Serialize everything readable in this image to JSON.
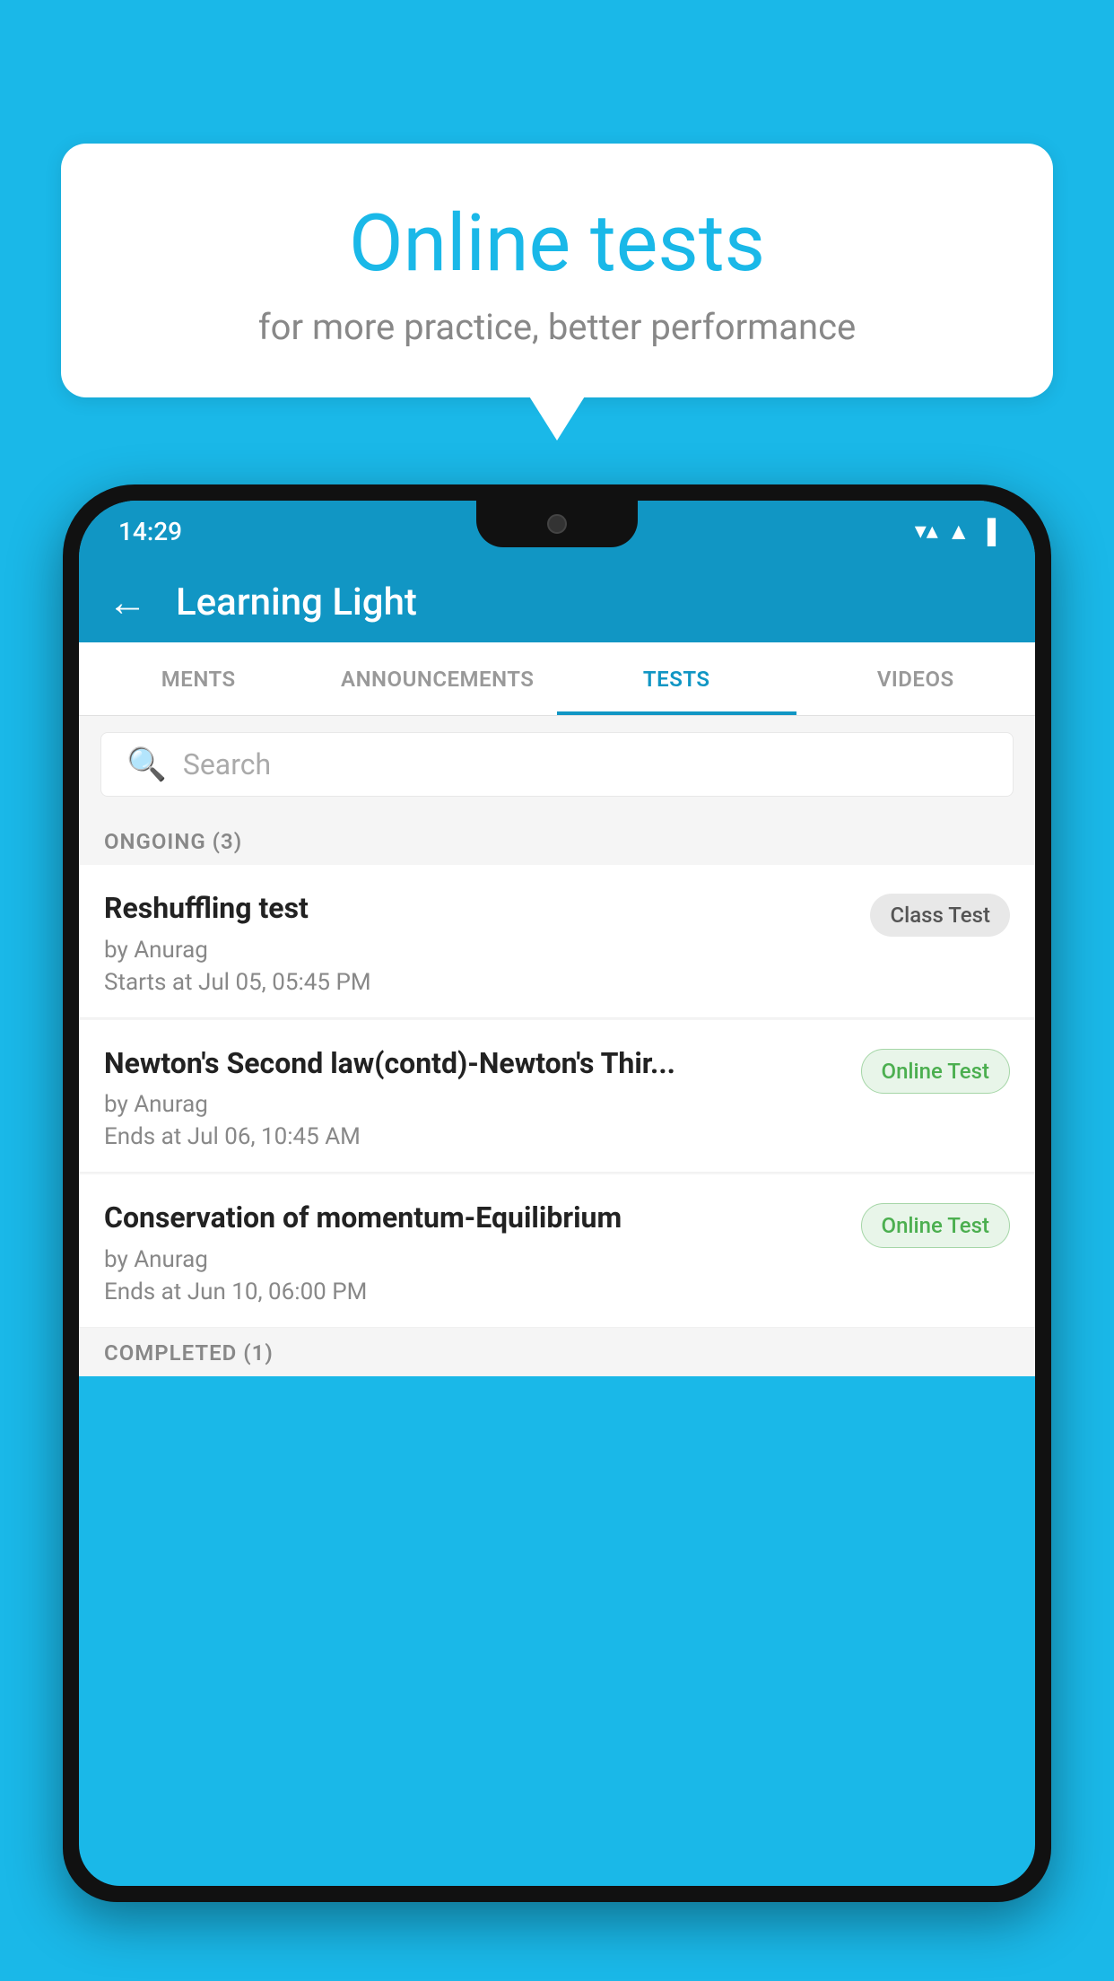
{
  "background": {
    "color": "#1ab8e8"
  },
  "speech_bubble": {
    "title": "Online tests",
    "subtitle": "for more practice, better performance"
  },
  "phone": {
    "status_bar": {
      "time": "14:29",
      "wifi": "▼▲",
      "signal": "▲",
      "battery": "▌"
    },
    "header": {
      "title": "Learning Light",
      "back_label": "←"
    },
    "tabs": [
      {
        "label": "MENTS",
        "active": false
      },
      {
        "label": "ANNOUNCEMENTS",
        "active": false
      },
      {
        "label": "TESTS",
        "active": true
      },
      {
        "label": "VIDEOS",
        "active": false
      }
    ],
    "search": {
      "placeholder": "Search"
    },
    "sections": [
      {
        "heading": "ONGOING (3)",
        "tests": [
          {
            "name": "Reshuffling test",
            "author": "by Anurag",
            "date": "Starts at  Jul 05, 05:45 PM",
            "badge": "Class Test",
            "badge_type": "class"
          },
          {
            "name": "Newton's Second law(contd)-Newton's Thir...",
            "author": "by Anurag",
            "date": "Ends at  Jul 06, 10:45 AM",
            "badge": "Online Test",
            "badge_type": "online"
          },
          {
            "name": "Conservation of momentum-Equilibrium",
            "author": "by Anurag",
            "date": "Ends at  Jun 10, 06:00 PM",
            "badge": "Online Test",
            "badge_type": "online"
          }
        ]
      }
    ],
    "bottom_peek": "COMPLETED (1)"
  }
}
